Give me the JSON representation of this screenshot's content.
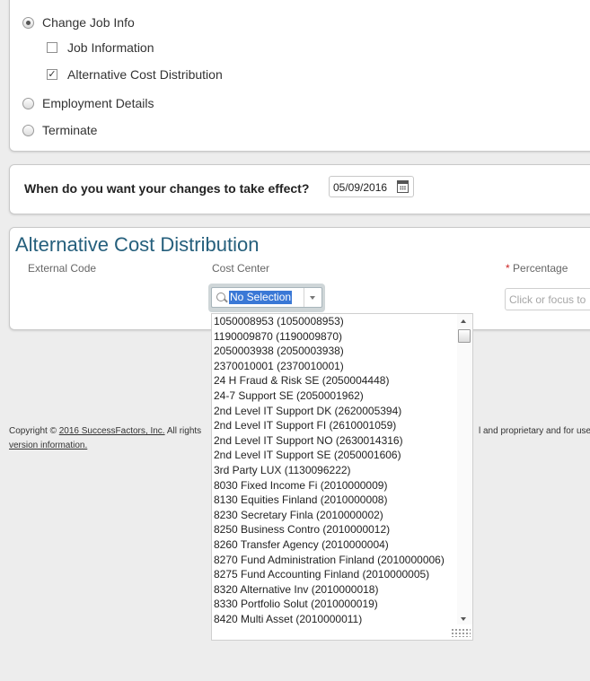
{
  "actions": {
    "change_job_info": "Change Job Info",
    "job_information": "Job Information",
    "alternative_cost_distribution": "Alternative Cost Distribution",
    "employment_details": "Employment Details",
    "terminate": "Terminate",
    "selected_radio": "change_job_info",
    "job_information_checked": false,
    "alternative_cost_distribution_checked": true
  },
  "effective_date": {
    "question": "When do you want your changes to take effect?",
    "value": "05/09/2016",
    "icon": "calendar-icon"
  },
  "acd": {
    "title": "Alternative Cost Distribution",
    "col_external_code": "External Code",
    "col_cost_center": "Cost Center",
    "col_percentage_required": "*",
    "col_percentage": "Percentage",
    "cost_center_value": "No Selection",
    "percentage_placeholder": "Click or focus to"
  },
  "cost_center_options": [
    "1050008953 (1050008953)",
    "1190009870 (1190009870)",
    "2050003938 (2050003938)",
    "2370010001 (2370010001)",
    "24 H Fraud & Risk SE (2050004448)",
    "24-7 Support SE (2050001962)",
    "2nd Level IT Support DK (2620005394)",
    "2nd Level IT Support FI (2610001059)",
    "2nd Level IT Support NO (2630014316)",
    "2nd Level IT Support SE (2050001606)",
    "3rd Party LUX (1130096222)",
    "8030 Fixed Income Fi (2010000009)",
    "8130 Equities Finland (2010000008)",
    "8230 Secretary Finla (2010000002)",
    "8250 Business Contro (2010000012)",
    "8260 Transfer Agency (2010000004)",
    "8270 Fund Administration Finland (2010000006)",
    "8275 Fund Accounting Finland (2010000005)",
    "8320 Alternative Inv (2010000018)",
    "8330 Portfolio Solut (2010000019)",
    "8420 Multi Asset (2010000011)"
  ],
  "footer": {
    "copyright_prefix": "Copyright ©",
    "copyright_link": "2016 SuccessFactors, Inc.",
    "copyright_suffix": "All rights",
    "right_text": "l and proprietary and for use",
    "version_link": "version information."
  },
  "colors": {
    "page_bg": "#ededed",
    "title": "#255f7c",
    "selection": "#3a78d6",
    "required": "#cc2222"
  }
}
